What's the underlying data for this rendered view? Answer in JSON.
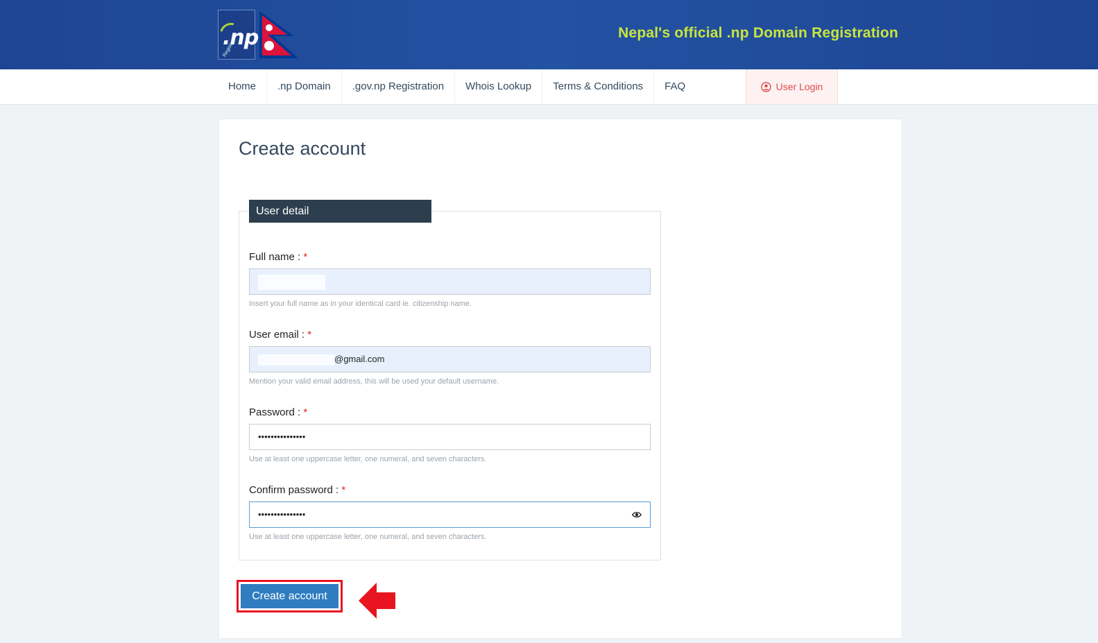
{
  "header": {
    "title": "Nepal's official .np Domain Registration",
    "logo_text": ".np",
    "logo_subtext": "Registry"
  },
  "nav": {
    "items": [
      {
        "label": "Home"
      },
      {
        "label": ".np Domain"
      },
      {
        "label": ".gov.np Registration"
      },
      {
        "label": "Whois Lookup"
      },
      {
        "label": "Terms & Conditions"
      },
      {
        "label": "FAQ"
      }
    ],
    "login_label": "User Login"
  },
  "page": {
    "title": "Create account",
    "section_title": "User detail"
  },
  "form": {
    "full_name": {
      "label": "Full name :",
      "required_mark": "*",
      "value": "",
      "help": "Insert your full name as in your identical card ie. citizenship name."
    },
    "email": {
      "label": "User email :",
      "required_mark": "*",
      "value_visible": "@gmail.com",
      "help": "Mention your valid email address, this will be used your default username."
    },
    "password": {
      "label": "Password :",
      "required_mark": "*",
      "value": "•••••••••••••••",
      "help": "Use at least one uppercase letter, one numeral, and seven characters."
    },
    "confirm_password": {
      "label": "Confirm password :",
      "required_mark": "*",
      "value": "•••••••••••••••",
      "help": "Use at least one uppercase letter, one numeral, and seven characters."
    },
    "submit_label": "Create account"
  },
  "colors": {
    "header_bg": "#1f4b99",
    "header_title": "#c9e53f",
    "legend_bg": "#2d3f4e",
    "button_bg": "#2f7dc0",
    "highlight": "#e8141f",
    "login_text": "#e04b4b"
  }
}
